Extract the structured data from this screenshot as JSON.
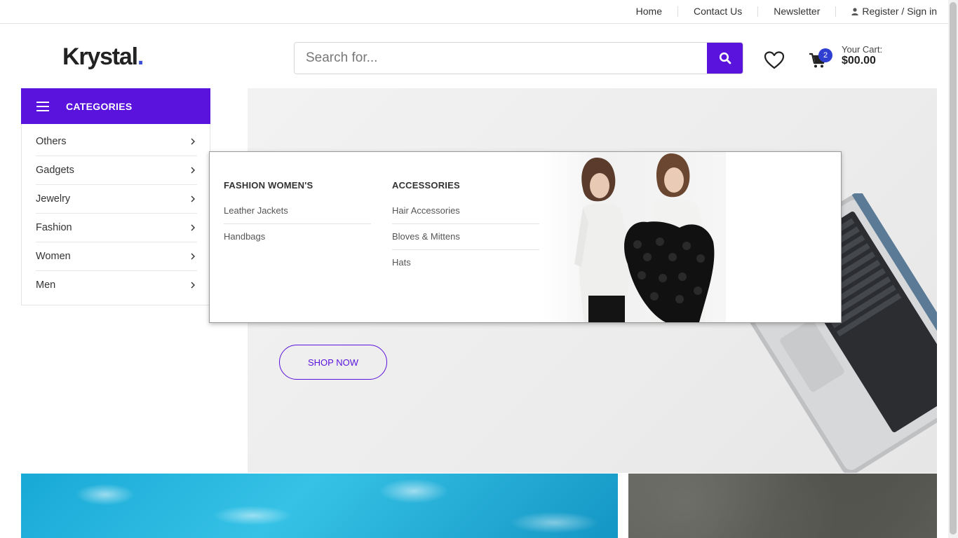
{
  "topnav": {
    "home": "Home",
    "contact": "Contact Us",
    "newsletter": "Newsletter",
    "account": "Register / Sign in"
  },
  "header": {
    "logo_text": "Krystal",
    "logo_dot": ".",
    "search_placeholder": "Search for...",
    "cart_count": "2",
    "cart_label": "Your Cart:",
    "cart_total": "$00.00"
  },
  "categories": {
    "title": "CATEGORIES",
    "items": [
      "Others",
      "Gadgets",
      "Jewelry",
      "Fashion",
      "Women",
      "Men"
    ]
  },
  "mega_menu": {
    "columns": [
      {
        "title": "FASHION WOMEN'S",
        "links": [
          "Leather Jackets",
          "Handbags"
        ]
      },
      {
        "title": "ACCESSORIES",
        "links": [
          "Hair Accessories",
          "Bloves & Mittens",
          "Hats"
        ]
      }
    ]
  },
  "hero": {
    "cta": "SHOP NOW"
  },
  "colors": {
    "accent": "#5a12dd",
    "badge": "#2e3fd1",
    "logo_dot": "#3a4fd6"
  },
  "icons": [
    "user-icon",
    "search-icon",
    "heart-icon",
    "cart-icon",
    "hamburger-icon",
    "chevron-right-icon"
  ]
}
